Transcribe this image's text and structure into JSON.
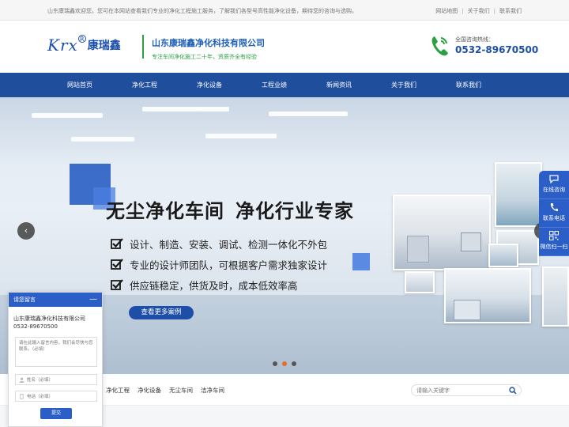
{
  "topbar": {
    "welcome": "山东康瑞鑫欢迎您，您可在本网站查看我们专业的净化工程施工服务，了解我们各型号高性能净化设备，期待您的咨询与选购。",
    "links": [
      "网站地图",
      "关于我们",
      "联系我们"
    ]
  },
  "header": {
    "logo_latin": "Krx",
    "logo_reg": "R",
    "logo_cn": "康瑞鑫",
    "company_name": "山东康瑞鑫净化科技有限公司",
    "slogan": "专注车间净化施工二十年，资质齐全有经验",
    "hotline_label": "全国咨询热线：",
    "hotline_number": "0532-89670500"
  },
  "nav": {
    "items": [
      "网站首页",
      "净化工程",
      "净化设备",
      "工程业绩",
      "新闻资讯",
      "关于我们",
      "联系我们"
    ]
  },
  "banner": {
    "headline_a": "无尘净化车间",
    "headline_b": "净化行业专家",
    "bullets": [
      "设计、制造、安装、调试、检测一体化不外包",
      "专业的设计师团队，可根据客户需求独家设计",
      "供应链稳定，供货及时，成本低效率高"
    ],
    "button": "查看更多案例",
    "arrow_left": "‹",
    "arrow_right": "›",
    "slide_count": 3,
    "active_slide": 2
  },
  "float_bar": {
    "items": [
      {
        "label": "在线咨询",
        "icon": "chat-icon"
      },
      {
        "label": "联系电话",
        "icon": "phone-icon"
      },
      {
        "label": "微信扫一扫",
        "icon": "qrcode-icon"
      }
    ]
  },
  "keywords": {
    "items": [
      "净化工程",
      "净化设备",
      "无尘车间",
      "洁净车间"
    ]
  },
  "search": {
    "placeholder": "请输入关键字"
  },
  "message_form": {
    "title": "请您留言",
    "minimize": "—",
    "company": "山东康瑞鑫净化科技有限公司0532-89670500",
    "content_placeholder": "请在此输入留言内容，我们会尽快与您联系。（必填）",
    "name_placeholder": "姓名（必填）",
    "phone_placeholder": "电话（必填）",
    "submit": "提交"
  },
  "colors": {
    "brand_blue": "#1e4e9c",
    "accent_green": "#2aa043",
    "active_dot": "#e86c2c"
  }
}
